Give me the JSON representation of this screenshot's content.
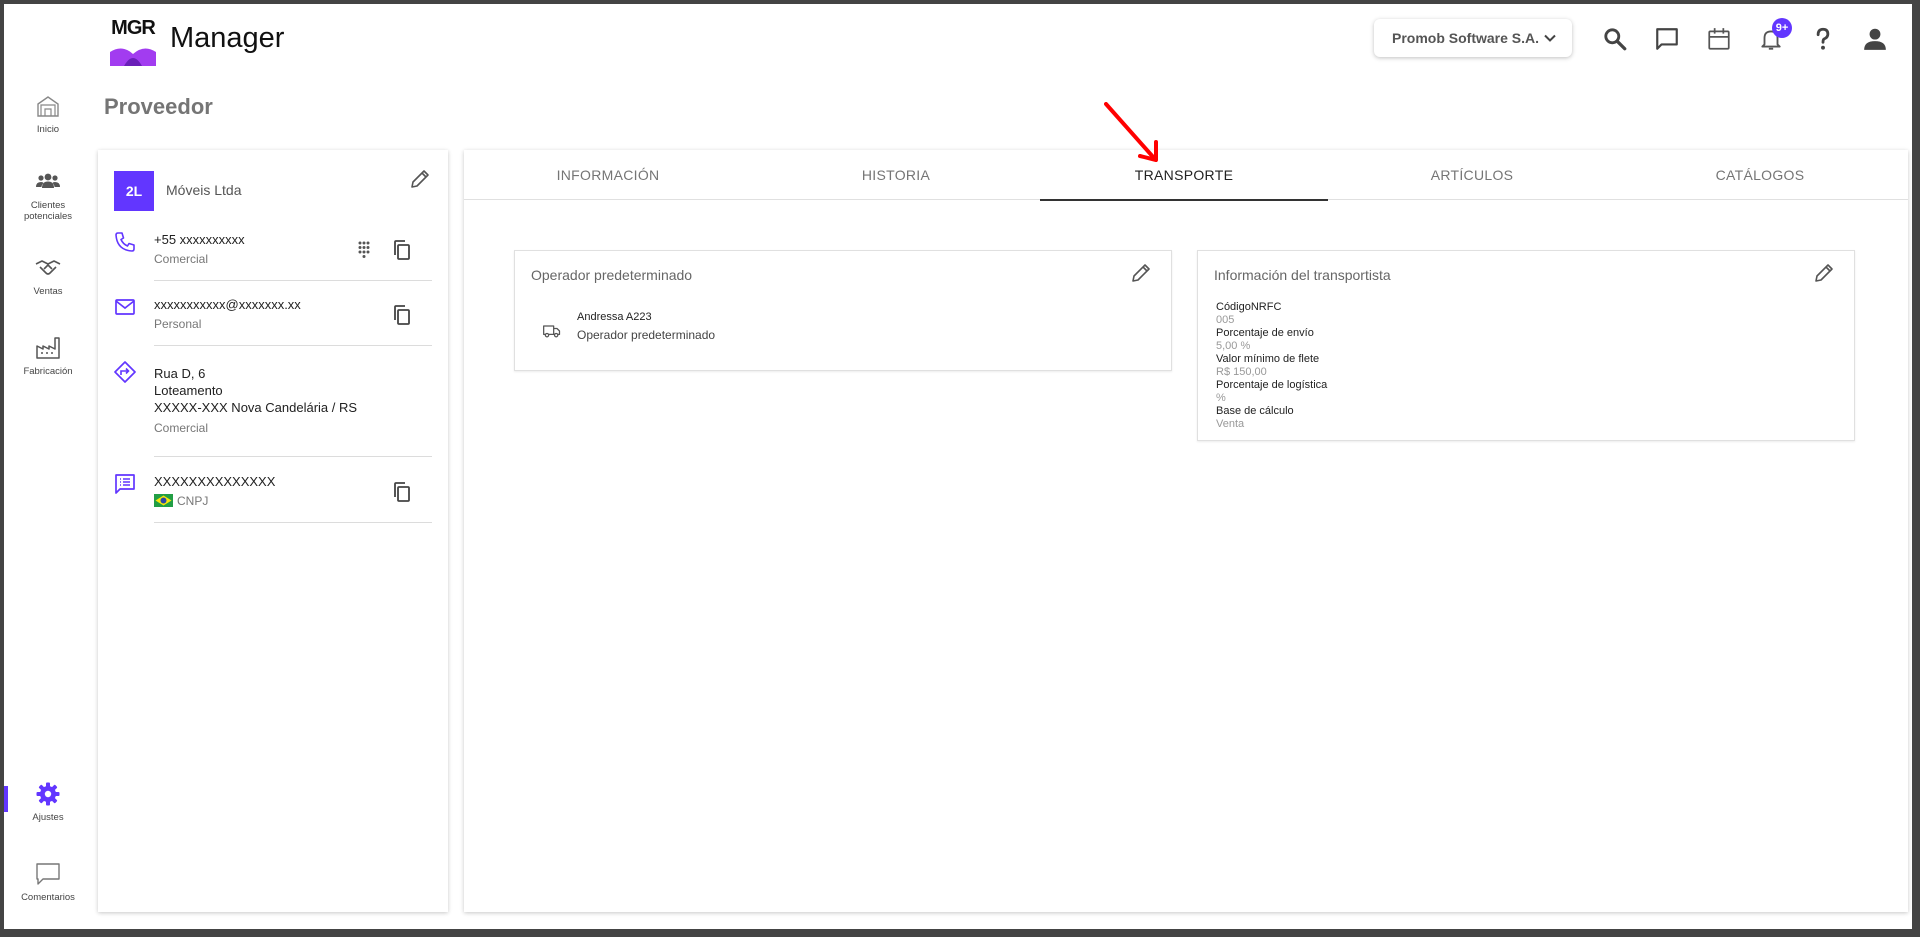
{
  "app": {
    "logo_text": "MGR",
    "title": "Manager",
    "company_selector": "Promob Software S.A.",
    "notifications_badge": "9+"
  },
  "nav": {
    "items": [
      {
        "label": "Inicio",
        "icon": "home-icon"
      },
      {
        "label": "Clientes potenciales",
        "icon": "people-icon"
      },
      {
        "label": "Ventas",
        "icon": "handshake-icon"
      },
      {
        "label": "Fabricación",
        "icon": "factory-icon"
      }
    ],
    "bottom": [
      {
        "label": "Ajustes",
        "icon": "gear-icon"
      },
      {
        "label": "Comentarios",
        "icon": "comment-icon"
      }
    ]
  },
  "page": {
    "title": "Proveedor"
  },
  "supplier": {
    "avatar": "2L",
    "name": "Móveis Ltda",
    "phone": "+55 xxxxxxxxxx",
    "phone_type": "Comercial",
    "email": "xxxxxxxxxxx@xxxxxxx.xx",
    "email_type": "Personal",
    "address_line1": "Rua D, 6",
    "address_line2": "Loteamento",
    "address_line3": "XXXXX-XXX Nova Candelária / RS",
    "address_type": "Comercial",
    "document": "XXXXXXXXXXXXXX",
    "document_type": "CNPJ"
  },
  "tabs": [
    {
      "label": "INFORMACIÓN"
    },
    {
      "label": "HISTORIA"
    },
    {
      "label": "TRANSPORTE"
    },
    {
      "label": "ARTÍCULOS"
    },
    {
      "label": "CATÁLOGOS"
    }
  ],
  "operator_card": {
    "title": "Operador predeterminado",
    "name": "Andressa A223",
    "role": "Operador predeterminado"
  },
  "carrier_card": {
    "title": "Información del transportista",
    "fields": [
      {
        "label": "CódigoNRFC",
        "value": "005"
      },
      {
        "label": "Porcentaje de envío",
        "value": "5,00 %"
      },
      {
        "label": "Valor mínimo de flete",
        "value": "R$ 150,00"
      },
      {
        "label": "Porcentaje de logística",
        "value": "%"
      },
      {
        "label": "Base de cálculo",
        "value": "Venta"
      }
    ]
  },
  "colors": {
    "accent": "#6236ff",
    "annotation_arrow": "#ff0000"
  }
}
